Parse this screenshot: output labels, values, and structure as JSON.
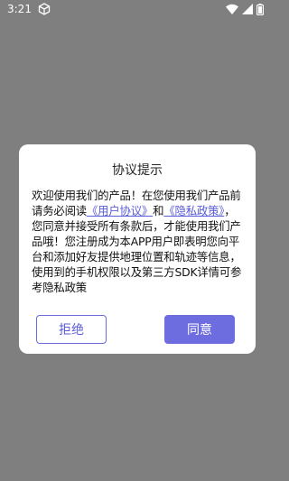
{
  "status_bar": {
    "time": "3:21",
    "icons": [
      "settings-icon",
      "wifi-icon",
      "signal-icon",
      "battery-icon"
    ]
  },
  "dialog": {
    "title": "协议提示",
    "body_part1": "欢迎使用我们的产品！在您使用我们产品前请务必阅读",
    "user_agreement_link": "《用户协议》",
    "connector": "和",
    "privacy_policy_link": "《隐私政策》",
    "body_part2": "，您同意并接受所有条款后，才能使用我们产品哦！您注册成为本APP用户即表明您向平台和添加好友提供地理位置和轨迹等信息，使用到的手机权限以及第三方SDK详情可参考隐私政策",
    "refuse_label": "拒绝",
    "agree_label": "同意"
  },
  "colors": {
    "accent": "#6d6de0",
    "overlay": "#7f7f7f"
  }
}
